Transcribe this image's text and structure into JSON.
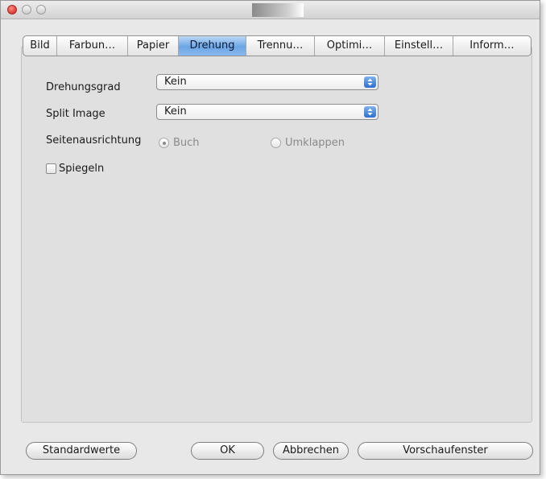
{
  "window": {
    "title": ""
  },
  "tabs": [
    {
      "label": "Bild",
      "selected": false
    },
    {
      "label": "Farbun…",
      "selected": false
    },
    {
      "label": "Papier",
      "selected": false
    },
    {
      "label": "Drehung",
      "selected": true
    },
    {
      "label": "Trennu…",
      "selected": false
    },
    {
      "label": "Optimi…",
      "selected": false
    },
    {
      "label": "Einstell…",
      "selected": false
    },
    {
      "label": "Inform…",
      "selected": false
    }
  ],
  "settings": {
    "rotation": {
      "label": "Drehungsgrad",
      "value": "Kein"
    },
    "split_image": {
      "label": "Split Image",
      "value": "Kein"
    },
    "orientation": {
      "label": "Seitenausrichtung",
      "options": [
        {
          "label": "Buch",
          "selected": true,
          "enabled": false
        },
        {
          "label": "Umklappen",
          "selected": false,
          "enabled": false
        }
      ]
    },
    "mirror": {
      "label": "Spiegeln",
      "checked": false
    }
  },
  "buttons": {
    "defaults": "Standardwerte",
    "ok": "OK",
    "cancel": "Abbrechen",
    "preview": "Vorschaufenster"
  },
  "colors": {
    "selected_tab": "#6ba5e5",
    "popup_arrow": "#2d6fd0",
    "close_button": "#e0443b",
    "disabled_text": "#8a8a8a"
  }
}
